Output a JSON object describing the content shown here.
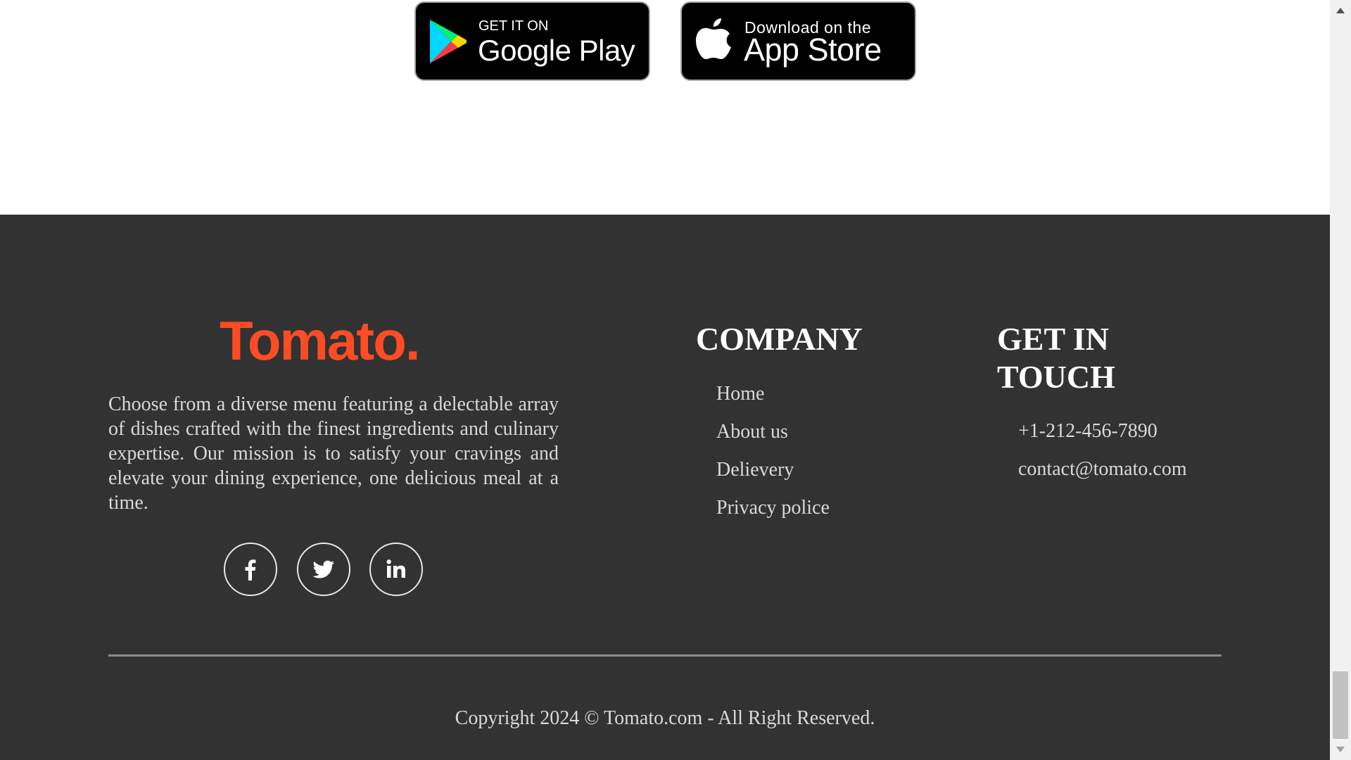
{
  "app_download": {
    "google_play": {
      "small_text": "GET IT ON",
      "big_text": "Google Play",
      "icon": "google-play-icon"
    },
    "app_store": {
      "small_text": "Download on the",
      "big_text": "App Store",
      "icon": "apple-icon"
    }
  },
  "footer": {
    "brand": {
      "logo_text": "Tomato.",
      "logo_color": "#ff4c24",
      "description": "Choose from a diverse menu featuring a delectable array of dishes crafted with the finest ingredients and culinary expertise. Our mission is to satisfy your cravings and elevate your dining experience, one delicious meal at a time."
    },
    "social": [
      {
        "name": "facebook",
        "icon": "facebook-icon"
      },
      {
        "name": "twitter",
        "icon": "twitter-icon"
      },
      {
        "name": "linkedin",
        "icon": "linkedin-icon"
      }
    ],
    "company": {
      "title": "COMPANY",
      "links": [
        "Home",
        "About us",
        "Delievery",
        "Privacy police"
      ]
    },
    "contact": {
      "title": "GET IN TOUCH",
      "items": [
        "+1-212-456-7890",
        "contact@tomato.com"
      ]
    },
    "copyright": "Copyright 2024 © Tomato.com - All Right Reserved."
  },
  "colors": {
    "footer_bg": "#323232",
    "accent": "#ff4c24",
    "text": "#d9d9d9"
  }
}
